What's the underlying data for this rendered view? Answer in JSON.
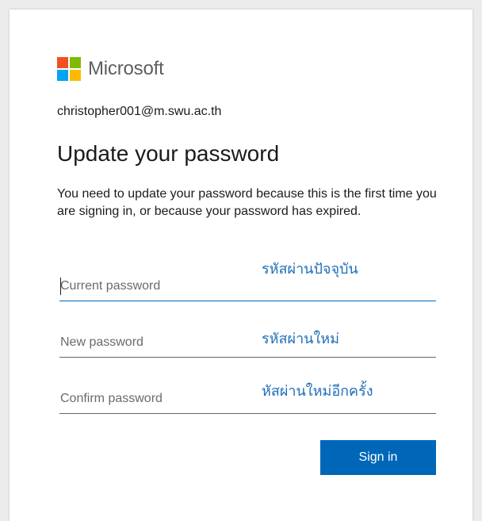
{
  "brand": {
    "name": "Microsoft",
    "logo_colors": [
      "#f25022",
      "#7fba00",
      "#00a4ef",
      "#ffb900"
    ]
  },
  "account": {
    "email": "christopher001@m.swu.ac.th"
  },
  "page": {
    "title": "Update your password",
    "description": "You need to update your password because this is the first time you are signing in, or because your password has expired."
  },
  "fields": {
    "current_password": {
      "placeholder": "Current password",
      "value": ""
    },
    "new_password": {
      "placeholder": "New password",
      "value": ""
    },
    "confirm_password": {
      "placeholder": "Confirm password",
      "value": ""
    }
  },
  "annotations": {
    "current": "รหัสผ่านปัจจุบัน",
    "new": "รหัสผ่านใหม่",
    "confirm": "หัสผ่านใหม่อีกครั้ง"
  },
  "actions": {
    "sign_in_label": "Sign in"
  },
  "colors": {
    "accent": "#0067b8",
    "annotation": "#1f6fb8"
  }
}
